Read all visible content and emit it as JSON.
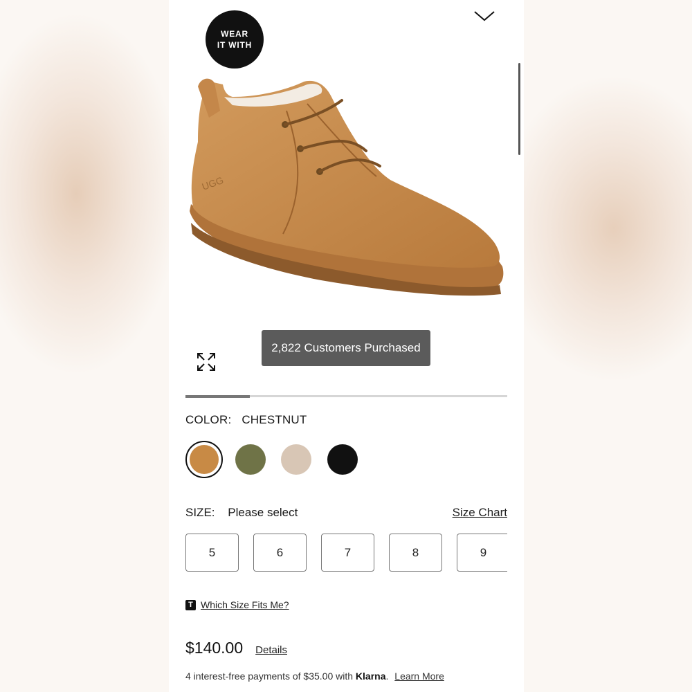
{
  "badge": {
    "line1": "WEAR",
    "line2": "IT WITH"
  },
  "gallery": {
    "purchased_label": "2,822 Customers Purchased",
    "progress_fraction": 0.2
  },
  "color": {
    "label": "COLOR:",
    "selected": "CHESTNUT",
    "swatches": [
      {
        "name": "chestnut",
        "hex": "#c88a45"
      },
      {
        "name": "olive",
        "hex": "#6f7347"
      },
      {
        "name": "sand",
        "hex": "#d8c6b5"
      },
      {
        "name": "black",
        "hex": "#111111"
      }
    ]
  },
  "size": {
    "label": "SIZE:",
    "value": "Please select",
    "chart_link": "Size Chart",
    "options": [
      "5",
      "6",
      "7",
      "8",
      "9"
    ]
  },
  "fit": {
    "icon_letter": "T",
    "link": "Which Size Fits Me?"
  },
  "price": {
    "amount": "$140.00",
    "details_link": "Details"
  },
  "klarna": {
    "prefix": "4 interest-free payments of $35.00 with",
    "brand": "Klarna",
    "dot": ".",
    "learn_more": "Learn More"
  }
}
